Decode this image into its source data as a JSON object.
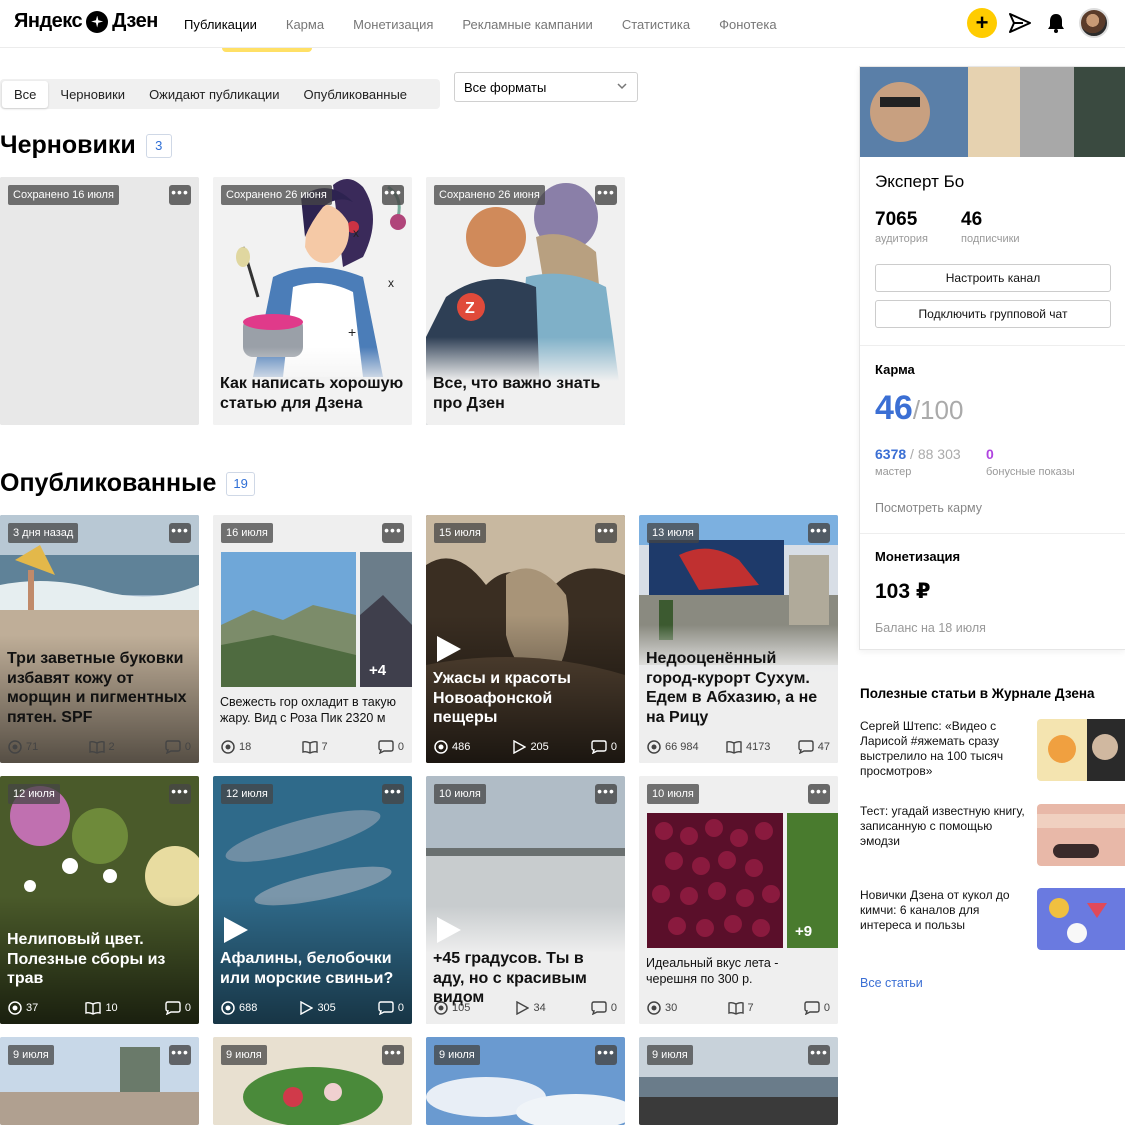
{
  "header": {
    "logo_left": "Яндекс",
    "logo_right": "Дзен",
    "nav": [
      "Публикации",
      "Карма",
      "Монетизация",
      "Рекламные кампании",
      "Статистика",
      "Фонотека"
    ],
    "add_label": "+"
  },
  "tabs": [
    "Все",
    "Черновики",
    "Ожидают публикации",
    "Опубликованные"
  ],
  "format_select": {
    "value": "Все форматы"
  },
  "drafts": {
    "title": "Черновики",
    "count": "3",
    "cards": [
      {
        "date": "Сохранено 16 июля",
        "title": ""
      },
      {
        "date": "Сохранено 26 июня",
        "title": "Как написать хорошую статью для Дзена"
      },
      {
        "date": "Сохранено 26 июня",
        "title": "Все, что важно знать про Дзен"
      }
    ]
  },
  "published": {
    "title": "Опубликованные",
    "count": "19",
    "cards": [
      {
        "date": "3 дня назад",
        "title": "Три заветные буковки избавят кожу от морщин и пигментных пятен. SPF",
        "views": "71",
        "reads": "2",
        "comments": "0"
      },
      {
        "date": "16 июля",
        "text": "Свежесть гор охладит в такую жару. Вид с Роза Пик 2320 м",
        "extra": "+4",
        "views": "18",
        "reads": "7",
        "comments": "0"
      },
      {
        "date": "15 июля",
        "title": "Ужасы и красоты Новоафонской пещеры",
        "views": "486",
        "plays": "205",
        "comments": "0"
      },
      {
        "date": "13 июля",
        "title": "Недооценённый город-курорт Сухум. Едем в Абхазию, а не на Рицу",
        "views": "66 984",
        "reads": "4173",
        "comments": "47"
      },
      {
        "date": "12 июля",
        "title": "Нелиповый цвет. Полезные сборы из трав",
        "views": "37",
        "reads": "10",
        "comments": "0"
      },
      {
        "date": "12 июля",
        "title": "Афалины, белобочки или морские свиньи?",
        "views": "688",
        "plays": "305",
        "comments": "0"
      },
      {
        "date": "10 июля",
        "title": "+45 градусов. Ты в аду, но с красивым видом",
        "views": "105",
        "plays": "34",
        "comments": "0"
      },
      {
        "date": "10 июля",
        "text": "Идеальный вкус лета - черешня по 300 р.",
        "extra": "+9",
        "views": "30",
        "reads": "7",
        "comments": "0"
      },
      {
        "date": "9 июля"
      },
      {
        "date": "9 июля"
      },
      {
        "date": "9 июля"
      },
      {
        "date": "9 июля"
      }
    ]
  },
  "profile": {
    "name": "Эксперт Бо",
    "audience": "7065",
    "audience_label": "аудитория",
    "subscribers": "46",
    "subscribers_label": "подписчики",
    "btn_setup": "Настроить канал",
    "btn_chat": "Подключить групповой чат",
    "karma_title": "Карма",
    "karma_value": "46",
    "karma_max": "/100",
    "karma_points": "6378",
    "karma_points_total": " / 88 303",
    "karma_points_label": "мастер",
    "bonus": "0",
    "bonus_label": "бонусные показы",
    "karma_link": "Посмотреть карму",
    "money_title": "Монетизация",
    "money_value": "103 ₽",
    "money_date": "Баланс на 18 июля"
  },
  "useful": {
    "title": "Полезные статьи в Журнале Дзена",
    "items": [
      "Сергей Штепс: «Видео с Ларисой #яжемать сразу выстрелило на 100 тысяч просмотров»",
      "Тест: угадай известную книгу, записанную с помощью эмодзи",
      "Новички Дзена от кукол до кимчи: 6 каналов для интереса и пользы"
    ],
    "all_link": "Все статьи"
  },
  "colors": {
    "accent": "#3b6fd4",
    "yellow": "#ffcc00",
    "bonus": "#b044e0"
  }
}
